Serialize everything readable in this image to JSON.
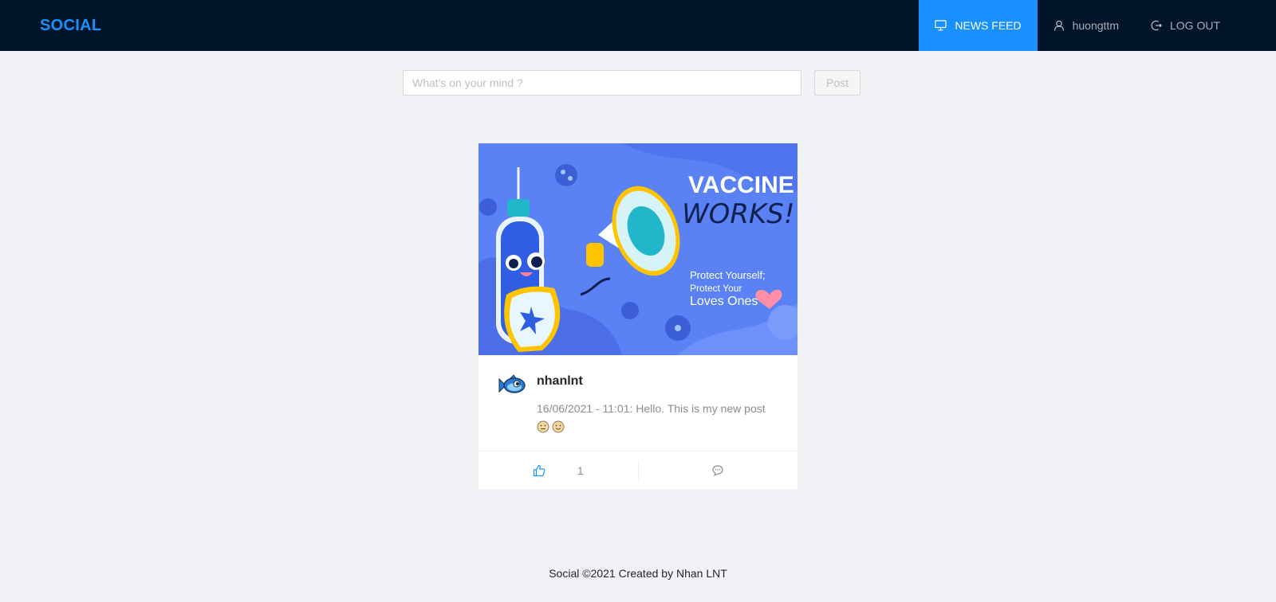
{
  "header": {
    "logo": "SOCIAL",
    "nav": [
      {
        "label": "NEWS FEED",
        "icon": "desktop-icon",
        "active": true
      },
      {
        "label": "huongttm",
        "icon": "user-icon",
        "active": false
      },
      {
        "label": "LOG OUT",
        "icon": "logout-icon",
        "active": false
      }
    ]
  },
  "composer": {
    "placeholder": "What's on your mind ?",
    "value": "",
    "post_label": "Post"
  },
  "post": {
    "image": {
      "headline_1": "VACCINE",
      "headline_2": "WORKS!",
      "tagline_1": "Protect Yourself;",
      "tagline_2": "Protect Your",
      "tagline_3": "Loves Ones"
    },
    "author": "nhanlnt",
    "description": "16/06/2021 - 11:01: Hello. This is my new post",
    "emojis": [
      "neutral-face",
      "slight-smile"
    ],
    "like_count": "1"
  },
  "footer": {
    "text": "Social ©2021 Created by Nhan LNT"
  },
  "colors": {
    "header_bg": "#001529",
    "accent": "#1890ff",
    "page_bg": "#f0f2f5"
  }
}
